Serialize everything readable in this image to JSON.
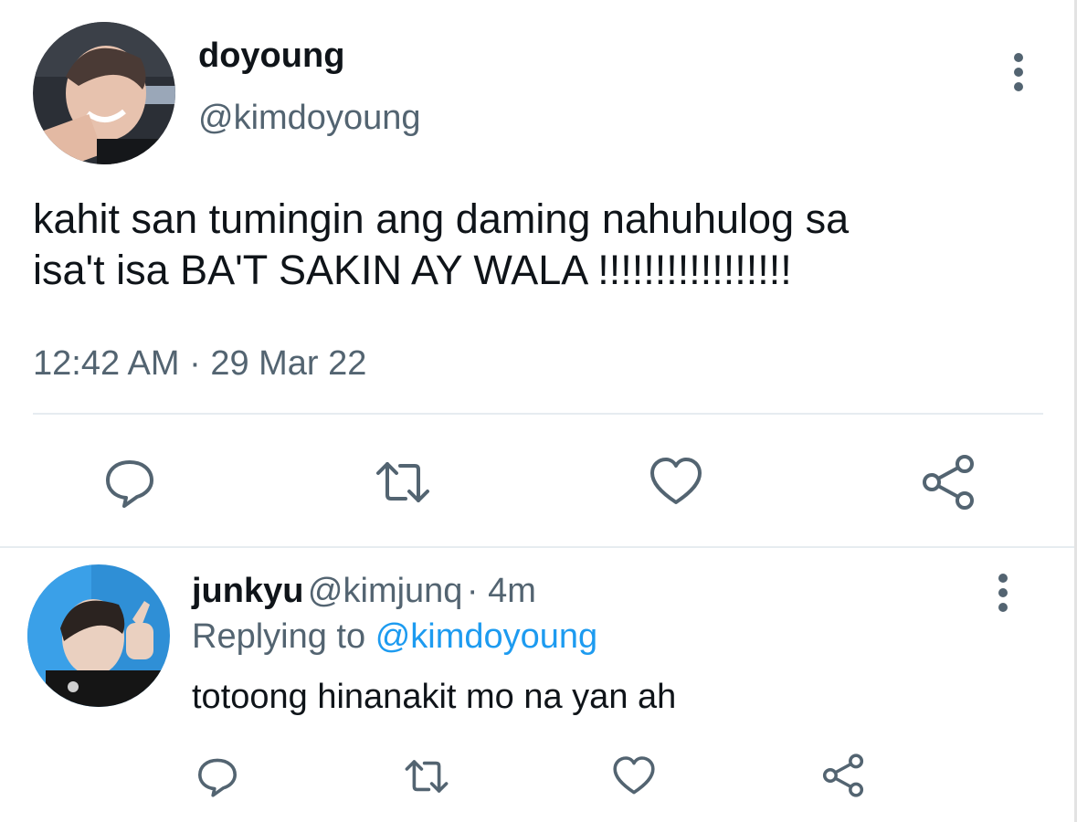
{
  "tweet": {
    "author_name": "doyoung",
    "author_handle": "@kimdoyoung",
    "text_line1": "kahit san tumingin ang daming nahuhulog sa",
    "text_line2": "isa't isa BA'T SAKIN AY WALA !!!!!!!!!!!!!!!!!",
    "timestamp": "12:42 AM · 29 Mar 22",
    "actions": [
      "reply-icon",
      "retweet-icon",
      "like-icon",
      "share-icon"
    ]
  },
  "reply": {
    "author_name": "junkyu",
    "author_handle": "@kimjunq",
    "time": "· 4m",
    "replying_prefix": "Replying to",
    "replying_to": "@kimdoyoung",
    "text": "totoong hinanakit mo na yan ah",
    "actions": [
      "reply-icon",
      "retweet-icon",
      "like-icon",
      "share-icon"
    ]
  },
  "colors": {
    "text_primary": "#0f1419",
    "text_secondary": "#536471",
    "accent": "#1d9bf0",
    "divider": "#e6ecf0"
  }
}
